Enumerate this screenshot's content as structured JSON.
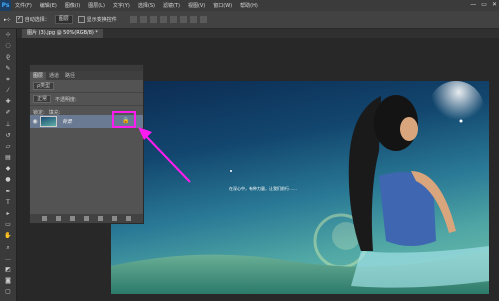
{
  "app": {
    "logo": "Ps",
    "window_controls": [
      "—",
      "▭",
      "✕"
    ]
  },
  "menu": [
    "文件(F)",
    "编辑(E)",
    "图像(I)",
    "图层(L)",
    "文字(Y)",
    "选择(S)",
    "滤镜(T)",
    "视图(V)",
    "窗口(W)",
    "帮助(H)"
  ],
  "options": {
    "auto_select_label": "自动选择：",
    "auto_select_value": "图层",
    "transform_label": "显示变换控件"
  },
  "document": {
    "tab_title": "图片 (3).jpg @ 50%(RGB/8) *"
  },
  "canvas": {
    "caption": "在深心中，有种力量，让我们前行……",
    "colors": {
      "sky_top": "#0c2b52",
      "sky_bottom": "#77c4b0"
    }
  },
  "layers_panel": {
    "tabs": [
      "图层",
      "通道",
      "路径"
    ],
    "filter_label": "ρ类型",
    "blend_mode": "正常",
    "opacity_label": "不透明度:",
    "lock_label": "锁定:",
    "fill_label": "填充:",
    "layer_name": "背景",
    "highlight_color": "#ff1cf0"
  }
}
